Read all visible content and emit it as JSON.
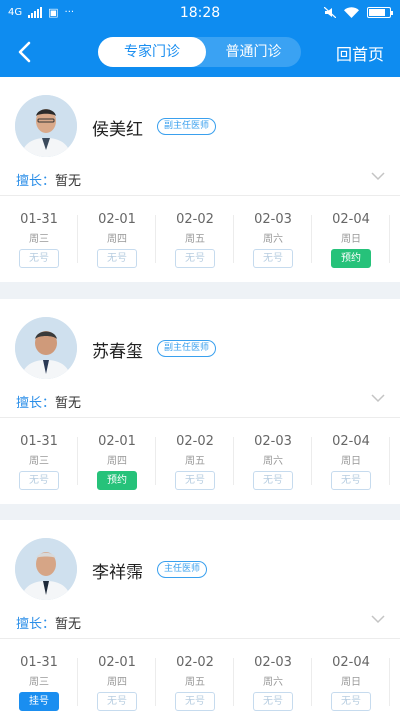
{
  "status_bar": {
    "network": "4G",
    "time": "18:28",
    "dots": "···"
  },
  "header": {
    "tabs": [
      {
        "label": "专家门诊",
        "active": true
      },
      {
        "label": "普通门诊",
        "active": false
      }
    ],
    "home_label": "回首页"
  },
  "accent_color": "#0e8cf0",
  "bookable_color": "#26c27a",
  "doctors": [
    {
      "name": "侯美红",
      "title": "副主任医师",
      "specialty_label": "擅长：",
      "specialty_value": "暂无",
      "schedule": [
        {
          "date": "01-31",
          "weekday": "周三",
          "status": "无号"
        },
        {
          "date": "02-01",
          "weekday": "周四",
          "status": "无号"
        },
        {
          "date": "02-02",
          "weekday": "周五",
          "status": "无号"
        },
        {
          "date": "02-03",
          "weekday": "周六",
          "status": "无号"
        },
        {
          "date": "02-04",
          "weekday": "周日",
          "status": "预约"
        }
      ]
    },
    {
      "name": "苏春玺",
      "title": "副主任医师",
      "specialty_label": "擅长：",
      "specialty_value": "暂无",
      "schedule": [
        {
          "date": "01-31",
          "weekday": "周三",
          "status": "无号"
        },
        {
          "date": "02-01",
          "weekday": "周四",
          "status": "预约"
        },
        {
          "date": "02-02",
          "weekday": "周五",
          "status": "无号"
        },
        {
          "date": "02-03",
          "weekday": "周六",
          "status": "无号"
        },
        {
          "date": "02-04",
          "weekday": "周日",
          "status": "无号"
        }
      ]
    },
    {
      "name": "李祥霈",
      "title": "主任医师",
      "specialty_label": "擅长：",
      "specialty_value": "暂无",
      "schedule": [
        {
          "date": "01-31",
          "weekday": "周三",
          "status": "挂号"
        },
        {
          "date": "02-01",
          "weekday": "周四",
          "status": "无号"
        },
        {
          "date": "02-02",
          "weekday": "周五",
          "status": "无号"
        },
        {
          "date": "02-03",
          "weekday": "周六",
          "status": "无号"
        },
        {
          "date": "02-04",
          "weekday": "周日",
          "status": "无号"
        }
      ]
    }
  ]
}
